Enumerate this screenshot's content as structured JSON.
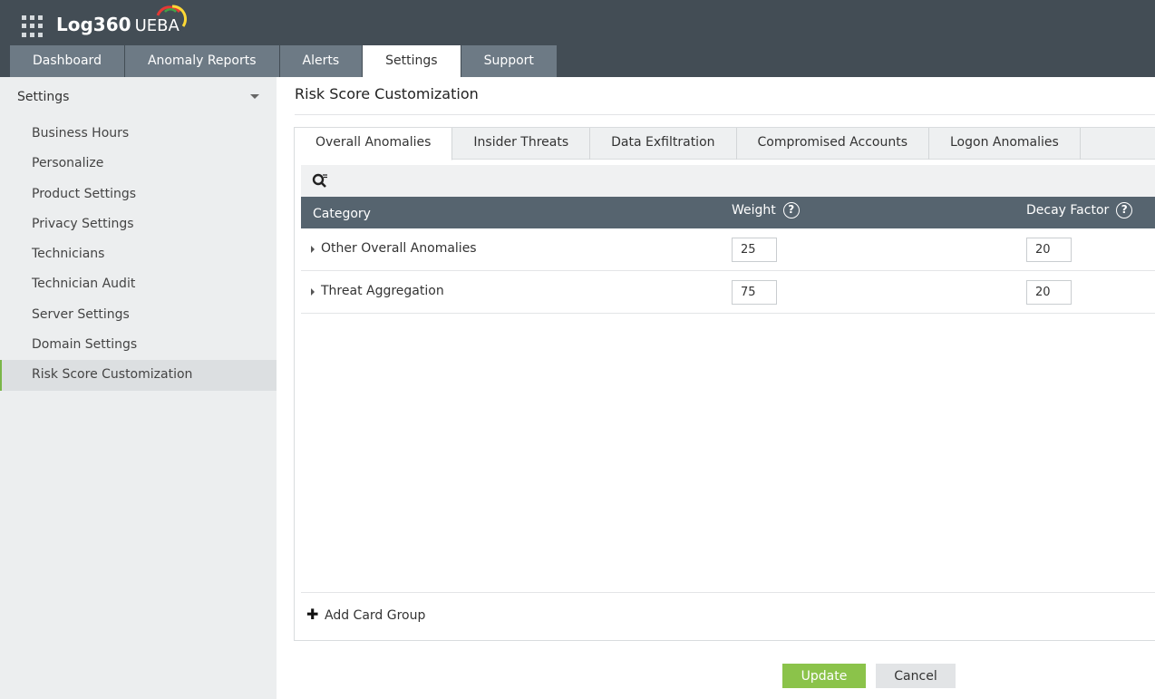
{
  "app": {
    "brand": "Log360",
    "product": "UEBA"
  },
  "top_tabs": [
    {
      "label": "Dashboard",
      "active": false
    },
    {
      "label": "Anomaly Reports",
      "active": false
    },
    {
      "label": "Alerts",
      "active": false
    },
    {
      "label": "Settings",
      "active": true
    },
    {
      "label": "Support",
      "active": false
    }
  ],
  "sidebar": {
    "header": "Settings",
    "items": [
      {
        "label": "Business Hours",
        "active": false
      },
      {
        "label": "Personalize",
        "active": false
      },
      {
        "label": "Product Settings",
        "active": false
      },
      {
        "label": "Privacy Settings",
        "active": false
      },
      {
        "label": "Technicians",
        "active": false
      },
      {
        "label": "Technician Audit",
        "active": false
      },
      {
        "label": "Server Settings",
        "active": false
      },
      {
        "label": "Domain Settings",
        "active": false
      },
      {
        "label": "Risk Score Customization",
        "active": true
      }
    ]
  },
  "page": {
    "title": "Risk Score Customization"
  },
  "sub_tabs": [
    {
      "label": "Overall Anomalies",
      "active": true
    },
    {
      "label": "Insider Threats",
      "active": false
    },
    {
      "label": "Data Exfiltration",
      "active": false
    },
    {
      "label": "Compromised Accounts",
      "active": false
    },
    {
      "label": "Logon Anomalies",
      "active": false
    }
  ],
  "grid": {
    "columns": {
      "category": "Category",
      "weight": "Weight",
      "decay": "Decay Factor"
    },
    "rows": [
      {
        "category": "Other Overall Anomalies",
        "weight": "25",
        "decay": "20"
      },
      {
        "category": "Threat Aggregation",
        "weight": "75",
        "decay": "20"
      }
    ]
  },
  "actions": {
    "add_group": "Add Card Group",
    "update": "Update",
    "cancel": "Cancel"
  },
  "colors": {
    "header_bg": "#434d55",
    "tab_bg": "#6d7a85",
    "grid_header_bg": "#56646f",
    "accent_green": "#8bc34a"
  }
}
